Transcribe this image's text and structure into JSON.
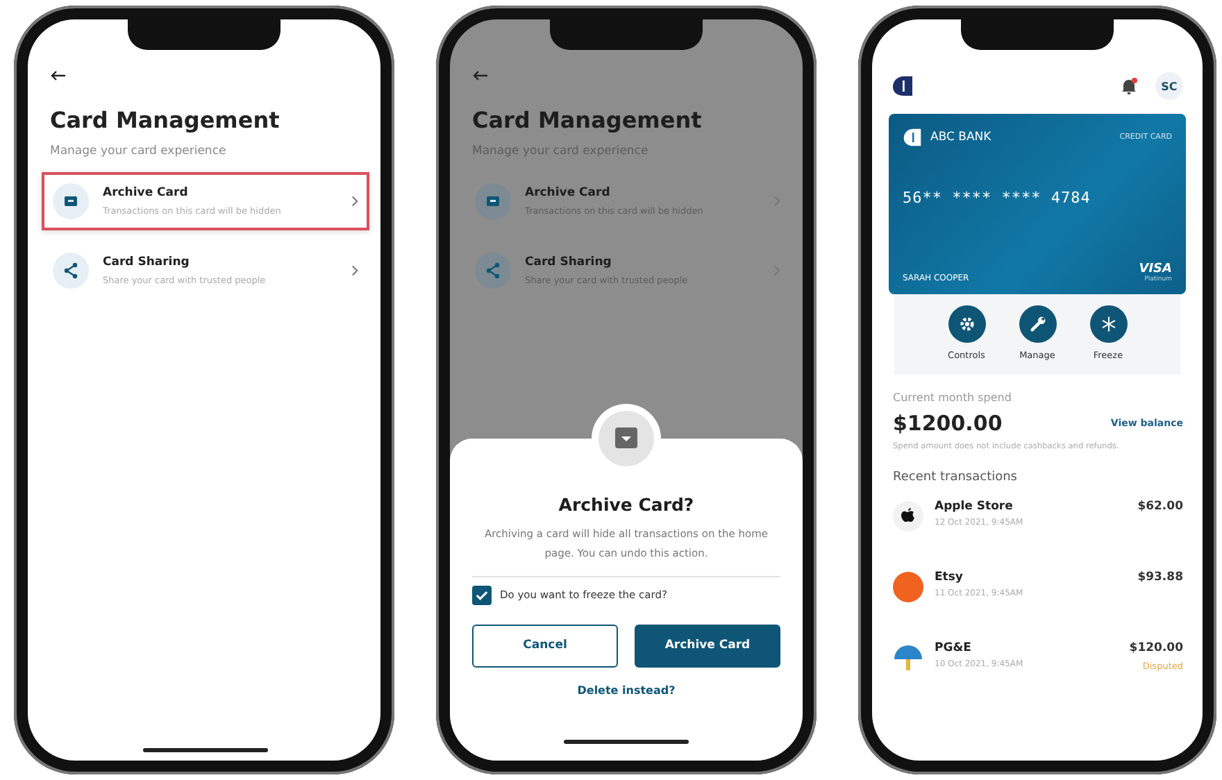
{
  "phones": [
    {
      "kind": "management",
      "dimmed": false,
      "title": "Card Management",
      "subtitle": "Manage your card experience",
      "items": [
        {
          "kind": "archive",
          "title": "Archive Card",
          "description": "Transactions on this card will be hidden",
          "highlighted": true
        },
        {
          "kind": "share",
          "title": "Card Sharing",
          "description": "Share your card with trusted people",
          "highlighted": false
        }
      ]
    },
    {
      "kind": "management",
      "dimmed": true,
      "title": "Card Management",
      "subtitle": "Manage your card experience",
      "items": [
        {
          "kind": "archive",
          "title": "Archive Card",
          "description": "Transactions on this card will be hidden",
          "highlighted": false
        },
        {
          "kind": "share",
          "title": "Card Sharing",
          "description": "Share your card with trusted people",
          "highlighted": false
        }
      ],
      "dialog": {
        "title": "Archive Card?",
        "message": "Archiving a card will hide all transactions on the home page. You can undo this action.",
        "checkbox": {
          "label": "Do you want to freeze the card?",
          "checked": true
        },
        "cancel": "Cancel",
        "confirm": "Archive Card",
        "link": "Delete instead?"
      }
    },
    {
      "kind": "home",
      "avatar": "SC",
      "notification": true,
      "card": {
        "bank": "ABC BANK",
        "type": "CREDIT CARD",
        "number": "56** **** **** 4784",
        "holder": "SARAH COOPER",
        "network": "VISA",
        "tier": "Platinum"
      },
      "actions": [
        {
          "kind": "gear",
          "label": "Controls"
        },
        {
          "kind": "wrench",
          "label": "Manage"
        },
        {
          "kind": "snowflake",
          "label": "Freeze"
        }
      ],
      "spend": {
        "label": "Current month spend",
        "amount": "$1200.00",
        "link": "View balance",
        "note": "Spend amount does not include cashbacks and refunds."
      },
      "transactions_title": "Recent transactions",
      "transactions": [
        {
          "kind": "apple",
          "name": "Apple Store",
          "date": "12 Oct 2021, 9:45AM",
          "amount": "$62.00"
        },
        {
          "kind": "etsy",
          "name": "Etsy",
          "date": "11 Oct 2021, 9:45AM",
          "amount": "$93.88"
        },
        {
          "kind": "utility",
          "name": "PG&E",
          "date": "10 Oct 2021, 9:45AM",
          "amount": "$120.00",
          "status": "Disputed"
        }
      ]
    }
  ]
}
